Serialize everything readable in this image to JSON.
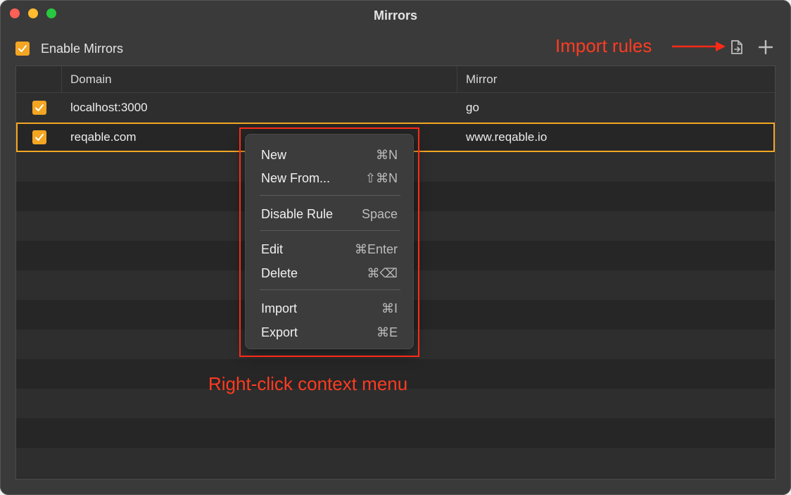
{
  "window": {
    "title": "Mirrors"
  },
  "toolbar": {
    "enable_label": "Enable Mirrors",
    "enable_checked": true
  },
  "annotations": {
    "import_rules": "Import rules",
    "context_menu": "Right-click context menu"
  },
  "icons": {
    "import": "file-import-icon",
    "add": "plus-icon",
    "check": "checkmark-icon"
  },
  "colors": {
    "accent": "#f4a622",
    "annotation": "#ff3b21"
  },
  "table": {
    "columns": [
      "Domain",
      "Mirror"
    ],
    "rows": [
      {
        "enabled": true,
        "domain": "localhost:3000",
        "mirror": "go"
      },
      {
        "enabled": true,
        "domain": "reqable.com",
        "mirror": "www.reqable.io",
        "selected": true
      }
    ]
  },
  "context_menu": {
    "items": [
      {
        "label": "New",
        "shortcut": "⌘N"
      },
      {
        "label": "New From...",
        "shortcut": "⇧⌘N"
      },
      {
        "label": "Disable Rule",
        "shortcut": "Space"
      },
      {
        "label": "Edit",
        "shortcut": "⌘Enter"
      },
      {
        "label": "Delete",
        "shortcut": "⌘⌫"
      },
      {
        "label": "Import",
        "shortcut": "⌘I"
      },
      {
        "label": "Export",
        "shortcut": "⌘E"
      }
    ]
  }
}
